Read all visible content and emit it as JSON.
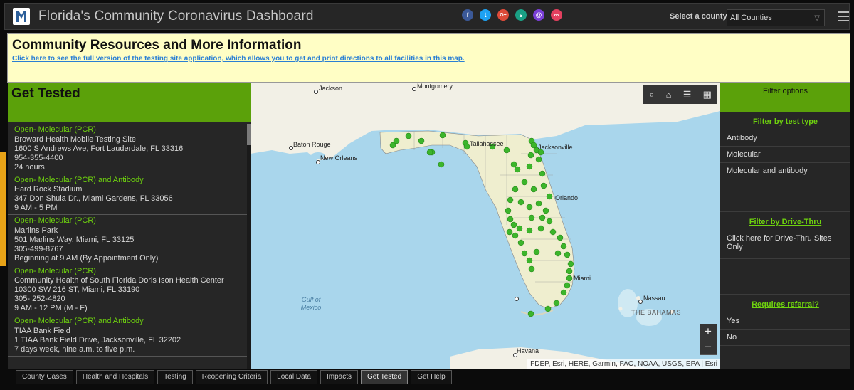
{
  "header": {
    "title": "Florida's Community Coronavirus Dashboard",
    "county_label": "Select a county",
    "county_value": "All Counties",
    "social": [
      {
        "icon": "facebook-icon",
        "glyph": "f",
        "color": "#3b5998"
      },
      {
        "icon": "twitter-icon",
        "glyph": "t",
        "color": "#1da1f2"
      },
      {
        "icon": "google-plus-icon",
        "glyph": "G+",
        "color": "#dd4b39"
      },
      {
        "icon": "share-icon",
        "glyph": "s",
        "color": "#1aa085"
      },
      {
        "icon": "email-icon",
        "glyph": "@",
        "color": "#7a3fd6"
      },
      {
        "icon": "link-icon",
        "glyph": "∞",
        "color": "#e4405f"
      }
    ]
  },
  "banner": {
    "title": "Community Resources and More Information",
    "link": "Click here to see the full version of the testing site application, which allows you to get and print directions to all facilities in this map."
  },
  "left_panel": {
    "title": "Get Tested",
    "sites": [
      {
        "type": "Open- Molecular (PCR)",
        "lines": [
          "Broward Health Mobile Testing Site",
          "1600 S Andrews Ave, Fort Lauderdale, FL 33316",
          "954-355-4400",
          "24 hours"
        ]
      },
      {
        "type": "Open- Molecular (PCR) and Antibody",
        "lines": [
          "Hard Rock Stadium",
          "347 Don Shula Dr., Miami Gardens, FL 33056",
          "9 AM - 5 PM"
        ]
      },
      {
        "type": "Open- Molecular (PCR)",
        "lines": [
          "Marlins Park",
          "501 Marlins Way, Miami, FL 33125",
          "305-499-8767",
          "Beginning at 9 AM (By Appointment Only)"
        ]
      },
      {
        "type": "Open- Molecular (PCR)",
        "lines": [
          "Community Health of South Florida Doris Ison Health Center",
          "10300 SW 216 ST, Miami, FL 33190",
          "305- 252-4820",
          "9 AM - 12 PM (M - F)"
        ]
      },
      {
        "type": "Open- Molecular (PCR) and Antibody",
        "lines": [
          "TIAA Bank Field",
          "1 TIAA Bank Field Drive, Jacksonville, FL 32202",
          "7 days week, nine a.m. to five p.m."
        ]
      }
    ]
  },
  "map": {
    "cities": [
      "Jackson",
      "Montgomery",
      "Baton Rouge",
      "New Orleans",
      "Tallahassee",
      "Jacksonville",
      "Orlando",
      "Miami",
      "Nassau",
      "THE BAHAMAS",
      "Havana"
    ],
    "sea_label": "Gulf of Mexico",
    "attribution": "FDEP, Esri, HERE, Garmin, FAO, NOAA, USGS, EPA | Esri",
    "zoom_in": "+",
    "zoom_out": "−",
    "colors": {
      "water": "#a9d6ec",
      "land": "#f2f0e6",
      "florida": "#efeecf",
      "marker": "#3cb52b"
    }
  },
  "filters": {
    "title": "Filter options",
    "by_test_type": {
      "label": "Filter by test type",
      "options": [
        "Antibody",
        "Molecular",
        "Molecular and antibody"
      ]
    },
    "by_drive_thru": {
      "label": "Filter by Drive-Thru",
      "options": [
        "Click here for Drive-Thru Sites Only"
      ]
    },
    "referral": {
      "label": "Requires referral?",
      "options": [
        "Yes",
        "No"
      ]
    }
  },
  "tabs": [
    {
      "label": "County Cases",
      "active": false
    },
    {
      "label": "Health and Hospitals",
      "active": false
    },
    {
      "label": "Testing",
      "active": false
    },
    {
      "label": "Reopening Criteria",
      "active": false
    },
    {
      "label": "Local Data",
      "active": false
    },
    {
      "label": "Impacts",
      "active": false
    },
    {
      "label": "Get Tested",
      "active": true
    },
    {
      "label": "Get Help",
      "active": false
    }
  ]
}
